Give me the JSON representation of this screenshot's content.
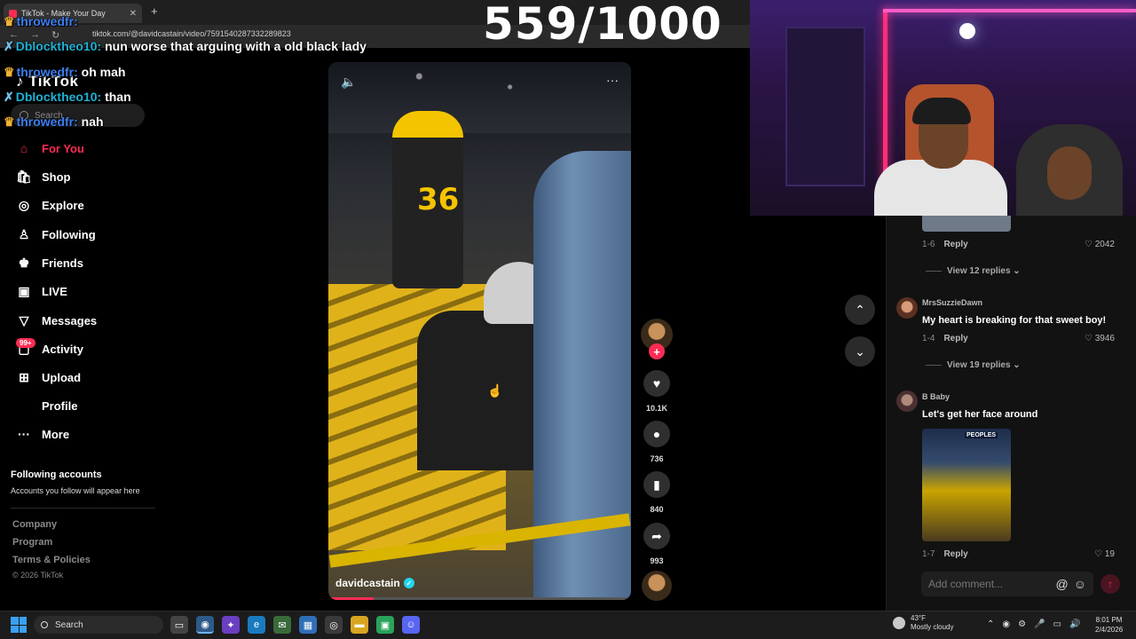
{
  "browser": {
    "tab_title": "TikTok - Make Your Day",
    "new_tab": "+",
    "url": "tiktok.com/@davidcastain/video/7591540287332289823"
  },
  "chat": [
    {
      "user": "throwedfr:",
      "msg": "",
      "badge": "crown"
    },
    {
      "user": "Dblocktheo10:",
      "msg": "nun worse that arguing with a old black lady",
      "badge": "sword"
    },
    {
      "user": "throwedfr:",
      "msg": "oh mah",
      "badge": "crown"
    },
    {
      "user": "Dblocktheo10:",
      "msg": "than",
      "badge": "sword"
    },
    {
      "user": "throwedfr:",
      "msg": "nah",
      "badge": "crown"
    }
  ],
  "counter": "559/1000",
  "sidebar": {
    "logo": "TikTok",
    "search_placeholder": "Search",
    "items": [
      {
        "label": "For You",
        "icon": "home-icon",
        "active": true
      },
      {
        "label": "Shop",
        "icon": "shop-icon"
      },
      {
        "label": "Explore",
        "icon": "compass-icon"
      },
      {
        "label": "Following",
        "icon": "following-icon"
      },
      {
        "label": "Friends",
        "icon": "friends-icon"
      },
      {
        "label": "LIVE",
        "icon": "live-icon"
      },
      {
        "label": "Messages",
        "icon": "messages-icon"
      },
      {
        "label": "Activity",
        "icon": "activity-icon"
      },
      {
        "label": "Upload",
        "icon": "upload-icon"
      },
      {
        "label": "Profile",
        "icon": ""
      },
      {
        "label": "More",
        "icon": "more-icon"
      }
    ],
    "activity_badge": "99+",
    "following_heading": "Following accounts",
    "following_sub": "Accounts you follow will appear here",
    "footer": [
      "Company",
      "Program",
      "Terms & Policies"
    ],
    "copyright": "© 2026 TikTok"
  },
  "video": {
    "author": "davidcastain",
    "jersey_number": "36",
    "progress": 0.15
  },
  "actions": {
    "likes": "10.1K",
    "comments": "736",
    "saves": "840",
    "shares": "993"
  },
  "comments": [
    {
      "meta_date": "1-6",
      "reply": "Reply",
      "likes": "2042",
      "view_replies": "View 12 replies"
    },
    {
      "name": "MrsSuzzieDawn",
      "text": "My heart is breaking for that sweet boy!",
      "meta_date": "1-4",
      "reply": "Reply",
      "likes": "3946",
      "view_replies": "View 19 replies"
    },
    {
      "name": "B Baby",
      "text": "Let's get her face around",
      "image_label": "PEOPLES",
      "meta_date": "1-7",
      "reply": "Reply",
      "likes": "19"
    }
  ],
  "comment_input_placeholder": "Add comment...",
  "taskbar": {
    "search": "Search",
    "weather_temp": "43°F",
    "weather_desc": "Mostly cloudy",
    "weather_badge": "1",
    "time": "8:01 PM",
    "date": "2/4/2026"
  },
  "colors": {
    "accent": "#fe2c55",
    "chat_user1": "#3c7df0",
    "chat_user2": "#1fb1d4"
  }
}
